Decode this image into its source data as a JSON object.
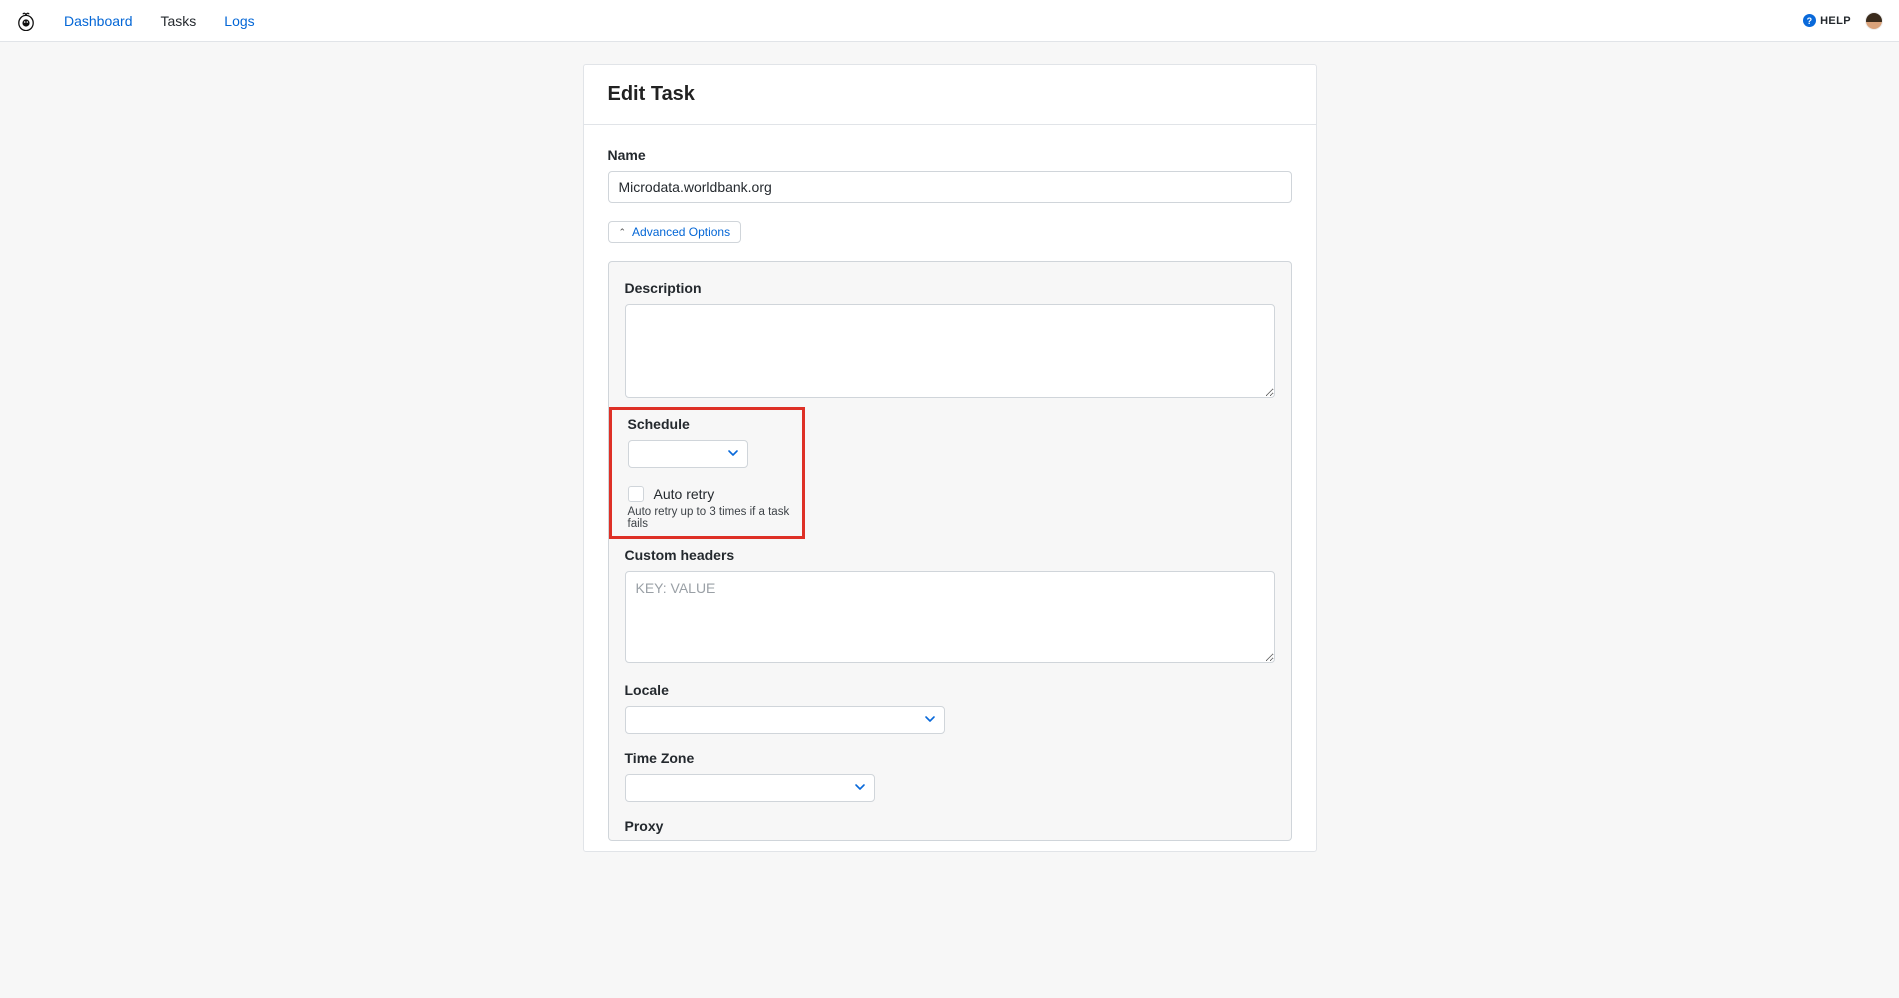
{
  "nav": {
    "dashboard": "Dashboard",
    "tasks": "Tasks",
    "logs": "Logs"
  },
  "header": {
    "help_label": "HELP"
  },
  "page": {
    "title": "Edit Task"
  },
  "form": {
    "name_label": "Name",
    "name_value": "Microdata.worldbank.org",
    "advanced_label": "Advanced Options",
    "description_label": "Description",
    "description_value": "",
    "schedule_label": "Schedule",
    "schedule_value": "",
    "auto_retry_label": "Auto retry",
    "auto_retry_help": "Auto retry up to 3 times if a task fails",
    "custom_headers_label": "Custom headers",
    "custom_headers_placeholder": "KEY: VALUE",
    "custom_headers_value": "",
    "locale_label": "Locale",
    "locale_value": "",
    "timezone_label": "Time Zone",
    "timezone_value": "",
    "proxy_label": "Proxy"
  }
}
